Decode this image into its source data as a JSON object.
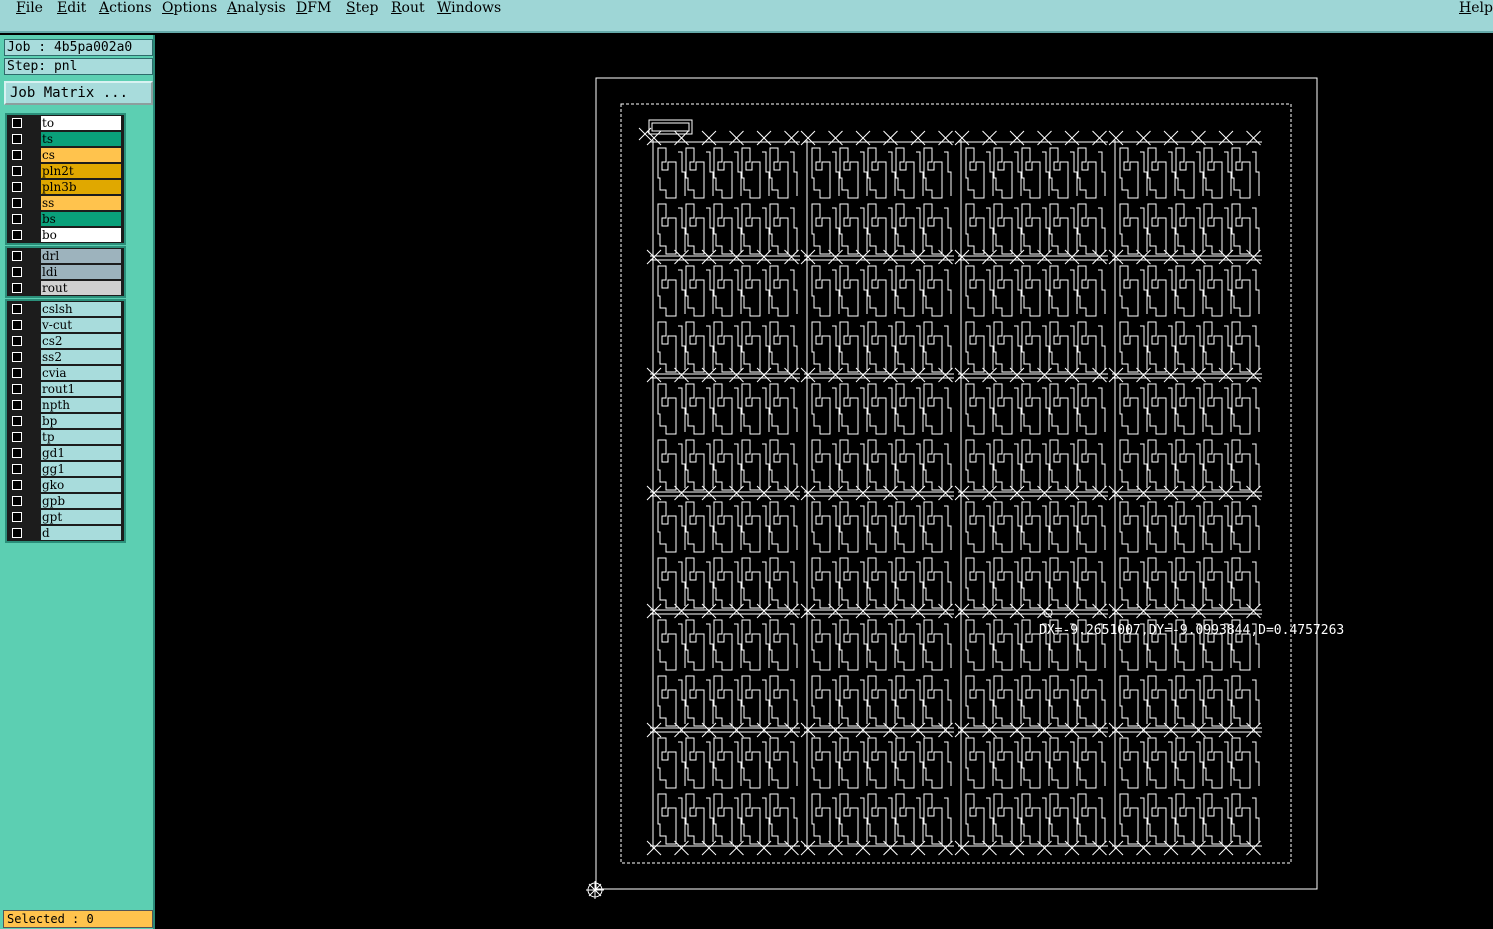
{
  "menubar": {
    "items": [
      "File",
      "Edit",
      "Actions",
      "Options",
      "Analysis",
      "DFM",
      "Step",
      "Rout",
      "Windows"
    ],
    "help": "Help"
  },
  "panel": {
    "job": "Job : 4b5pa002a0",
    "step": "Step: pnl",
    "job_matrix_button": "Job Matrix ..."
  },
  "layers": {
    "board": [
      {
        "name": "to",
        "color": "#ffffff"
      },
      {
        "name": "ts",
        "color": "#0aa07a"
      },
      {
        "name": "cs",
        "color": "#ffc34d"
      },
      {
        "name": "pln2t",
        "color": "#e0a800"
      },
      {
        "name": "pln3b",
        "color": "#e0a800"
      },
      {
        "name": "ss",
        "color": "#ffc34d"
      },
      {
        "name": "bs",
        "color": "#0aa07a"
      },
      {
        "name": "bo",
        "color": "#ffffff"
      }
    ],
    "drill": [
      {
        "name": "drl",
        "color": "#9db3bd"
      },
      {
        "name": "ldi",
        "color": "#9db3bd"
      },
      {
        "name": "rout",
        "color": "#d0d0d0"
      }
    ],
    "misc": [
      {
        "name": "cslsh",
        "color": "#a8dcdc"
      },
      {
        "name": "v-cut",
        "color": "#a8dcdc"
      },
      {
        "name": "cs2",
        "color": "#a8dcdc"
      },
      {
        "name": "ss2",
        "color": "#a8dcdc"
      },
      {
        "name": "cvia",
        "color": "#a8dcdc"
      },
      {
        "name": "rout1",
        "color": "#a8dcdc"
      },
      {
        "name": "npth",
        "color": "#a8dcdc"
      },
      {
        "name": "bp",
        "color": "#a8dcdc"
      },
      {
        "name": "tp",
        "color": "#a8dcdc"
      },
      {
        "name": "gd1",
        "color": "#a8dcdc"
      },
      {
        "name": "gg1",
        "color": "#a8dcdc"
      },
      {
        "name": "gko",
        "color": "#a8dcdc"
      },
      {
        "name": "gpb",
        "color": "#a8dcdc"
      },
      {
        "name": "gpt",
        "color": "#a8dcdc"
      },
      {
        "name": "d",
        "color": "#a8dcdc"
      }
    ]
  },
  "status": {
    "selected": "Selected : 0"
  },
  "canvas": {
    "measure_readout": "DX=-9.2651007,DY=-9.0993844,D=0.4757263",
    "panel": {
      "columns": 4,
      "pcbs_per_column": 5,
      "rows": 6
    }
  }
}
